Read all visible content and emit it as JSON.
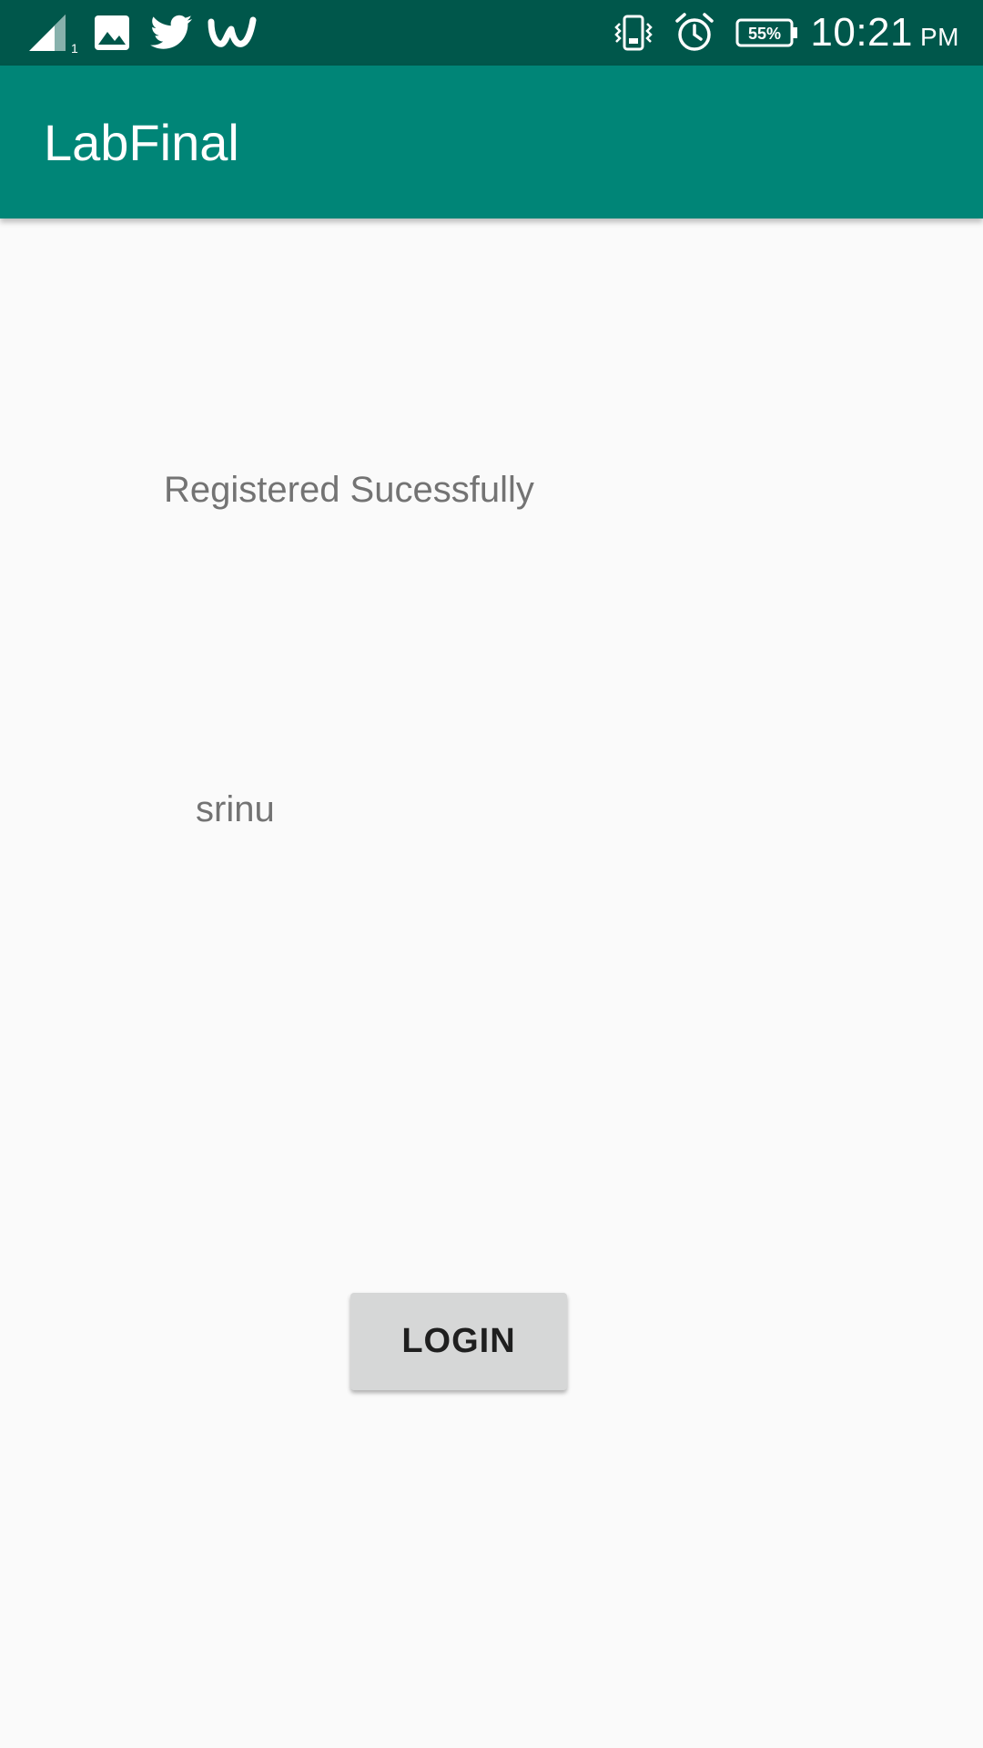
{
  "status_bar": {
    "icons": [
      "signal-icon",
      "gallery-icon",
      "twitter-icon",
      "wattpad-icon",
      "vibrate-icon",
      "alarm-icon",
      "battery-icon"
    ],
    "sim_slot": "1",
    "battery_percent": "55%",
    "time": "10:21",
    "ampm": "PM"
  },
  "app_bar": {
    "title": "LabFinal"
  },
  "main": {
    "message": "Registered Sucessfully",
    "username": "srinu",
    "login_label": "LOGIN"
  },
  "colors": {
    "status_bar": "#00574b",
    "app_bar": "#008577",
    "background": "#fafafa",
    "text_secondary": "#737373",
    "button_bg": "#d6d7d7"
  }
}
